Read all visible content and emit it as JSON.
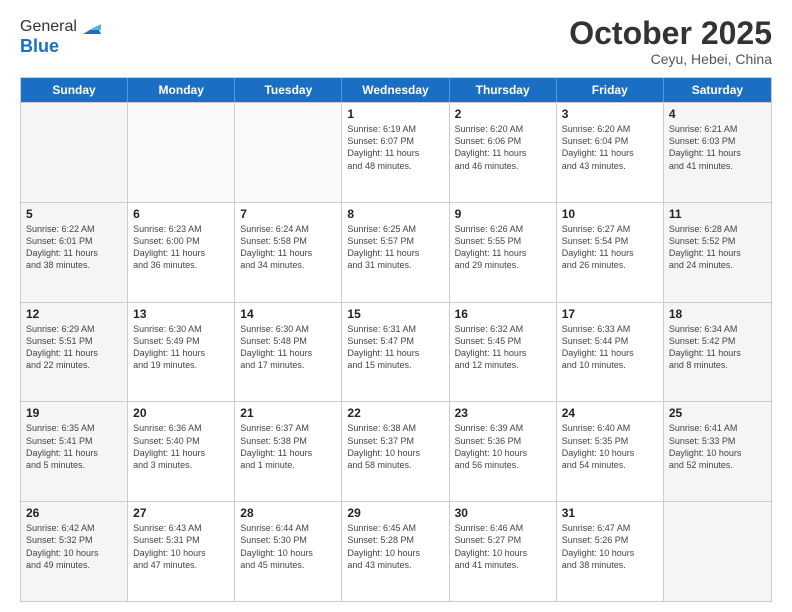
{
  "header": {
    "logo_line1": "General",
    "logo_line2": "Blue",
    "month": "October 2025",
    "location": "Ceyu, Hebei, China"
  },
  "weekdays": [
    "Sunday",
    "Monday",
    "Tuesday",
    "Wednesday",
    "Thursday",
    "Friday",
    "Saturday"
  ],
  "weeks": [
    [
      {
        "day": "",
        "info": ""
      },
      {
        "day": "",
        "info": ""
      },
      {
        "day": "",
        "info": ""
      },
      {
        "day": "1",
        "info": "Sunrise: 6:19 AM\nSunset: 6:07 PM\nDaylight: 11 hours\nand 48 minutes."
      },
      {
        "day": "2",
        "info": "Sunrise: 6:20 AM\nSunset: 6:06 PM\nDaylight: 11 hours\nand 46 minutes."
      },
      {
        "day": "3",
        "info": "Sunrise: 6:20 AM\nSunset: 6:04 PM\nDaylight: 11 hours\nand 43 minutes."
      },
      {
        "day": "4",
        "info": "Sunrise: 6:21 AM\nSunset: 6:03 PM\nDaylight: 11 hours\nand 41 minutes."
      }
    ],
    [
      {
        "day": "5",
        "info": "Sunrise: 6:22 AM\nSunset: 6:01 PM\nDaylight: 11 hours\nand 38 minutes."
      },
      {
        "day": "6",
        "info": "Sunrise: 6:23 AM\nSunset: 6:00 PM\nDaylight: 11 hours\nand 36 minutes."
      },
      {
        "day": "7",
        "info": "Sunrise: 6:24 AM\nSunset: 5:58 PM\nDaylight: 11 hours\nand 34 minutes."
      },
      {
        "day": "8",
        "info": "Sunrise: 6:25 AM\nSunset: 5:57 PM\nDaylight: 11 hours\nand 31 minutes."
      },
      {
        "day": "9",
        "info": "Sunrise: 6:26 AM\nSunset: 5:55 PM\nDaylight: 11 hours\nand 29 minutes."
      },
      {
        "day": "10",
        "info": "Sunrise: 6:27 AM\nSunset: 5:54 PM\nDaylight: 11 hours\nand 26 minutes."
      },
      {
        "day": "11",
        "info": "Sunrise: 6:28 AM\nSunset: 5:52 PM\nDaylight: 11 hours\nand 24 minutes."
      }
    ],
    [
      {
        "day": "12",
        "info": "Sunrise: 6:29 AM\nSunset: 5:51 PM\nDaylight: 11 hours\nand 22 minutes."
      },
      {
        "day": "13",
        "info": "Sunrise: 6:30 AM\nSunset: 5:49 PM\nDaylight: 11 hours\nand 19 minutes."
      },
      {
        "day": "14",
        "info": "Sunrise: 6:30 AM\nSunset: 5:48 PM\nDaylight: 11 hours\nand 17 minutes."
      },
      {
        "day": "15",
        "info": "Sunrise: 6:31 AM\nSunset: 5:47 PM\nDaylight: 11 hours\nand 15 minutes."
      },
      {
        "day": "16",
        "info": "Sunrise: 6:32 AM\nSunset: 5:45 PM\nDaylight: 11 hours\nand 12 minutes."
      },
      {
        "day": "17",
        "info": "Sunrise: 6:33 AM\nSunset: 5:44 PM\nDaylight: 11 hours\nand 10 minutes."
      },
      {
        "day": "18",
        "info": "Sunrise: 6:34 AM\nSunset: 5:42 PM\nDaylight: 11 hours\nand 8 minutes."
      }
    ],
    [
      {
        "day": "19",
        "info": "Sunrise: 6:35 AM\nSunset: 5:41 PM\nDaylight: 11 hours\nand 5 minutes."
      },
      {
        "day": "20",
        "info": "Sunrise: 6:36 AM\nSunset: 5:40 PM\nDaylight: 11 hours\nand 3 minutes."
      },
      {
        "day": "21",
        "info": "Sunrise: 6:37 AM\nSunset: 5:38 PM\nDaylight: 11 hours\nand 1 minute."
      },
      {
        "day": "22",
        "info": "Sunrise: 6:38 AM\nSunset: 5:37 PM\nDaylight: 10 hours\nand 58 minutes."
      },
      {
        "day": "23",
        "info": "Sunrise: 6:39 AM\nSunset: 5:36 PM\nDaylight: 10 hours\nand 56 minutes."
      },
      {
        "day": "24",
        "info": "Sunrise: 6:40 AM\nSunset: 5:35 PM\nDaylight: 10 hours\nand 54 minutes."
      },
      {
        "day": "25",
        "info": "Sunrise: 6:41 AM\nSunset: 5:33 PM\nDaylight: 10 hours\nand 52 minutes."
      }
    ],
    [
      {
        "day": "26",
        "info": "Sunrise: 6:42 AM\nSunset: 5:32 PM\nDaylight: 10 hours\nand 49 minutes."
      },
      {
        "day": "27",
        "info": "Sunrise: 6:43 AM\nSunset: 5:31 PM\nDaylight: 10 hours\nand 47 minutes."
      },
      {
        "day": "28",
        "info": "Sunrise: 6:44 AM\nSunset: 5:30 PM\nDaylight: 10 hours\nand 45 minutes."
      },
      {
        "day": "29",
        "info": "Sunrise: 6:45 AM\nSunset: 5:28 PM\nDaylight: 10 hours\nand 43 minutes."
      },
      {
        "day": "30",
        "info": "Sunrise: 6:46 AM\nSunset: 5:27 PM\nDaylight: 10 hours\nand 41 minutes."
      },
      {
        "day": "31",
        "info": "Sunrise: 6:47 AM\nSunset: 5:26 PM\nDaylight: 10 hours\nand 38 minutes."
      },
      {
        "day": "",
        "info": ""
      }
    ]
  ]
}
